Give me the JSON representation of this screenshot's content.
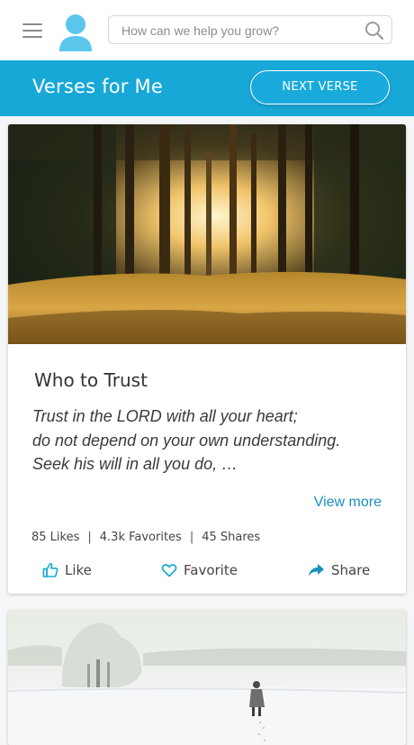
{
  "topbar": {
    "menu_icon": "hamburger-menu-icon",
    "avatar_icon": "user-avatar-icon",
    "search": {
      "placeholder": "How can we help you grow?",
      "value": "",
      "icon": "search-icon"
    }
  },
  "header": {
    "title": "Verses for Me",
    "next_button": "NEXT VERSE",
    "color": "#18a8d8"
  },
  "cards": [
    {
      "image": "sunlit-forest-photo",
      "title": "Who to Trust",
      "verse_lines": [
        "Trust in the LORD with all your heart;",
        "do not depend on your own understanding.",
        "Seek his will in all you do, …"
      ],
      "view_more": "View more",
      "stats": {
        "likes": "85 Likes",
        "favorites": "4.3k Favorites",
        "shares": "45 Shares",
        "separator": "|"
      },
      "actions": {
        "like": {
          "label": "Like",
          "icon": "thumbs-up-icon"
        },
        "favorite": {
          "label": "Favorite",
          "icon": "heart-icon"
        },
        "share": {
          "label": "Share",
          "icon": "share-arrow-icon"
        }
      }
    },
    {
      "image": "snowy-field-walker-photo"
    }
  ],
  "colors": {
    "accent": "#18a8d8",
    "link": "#1a8fc2",
    "avatar": "#5bc6ec"
  }
}
